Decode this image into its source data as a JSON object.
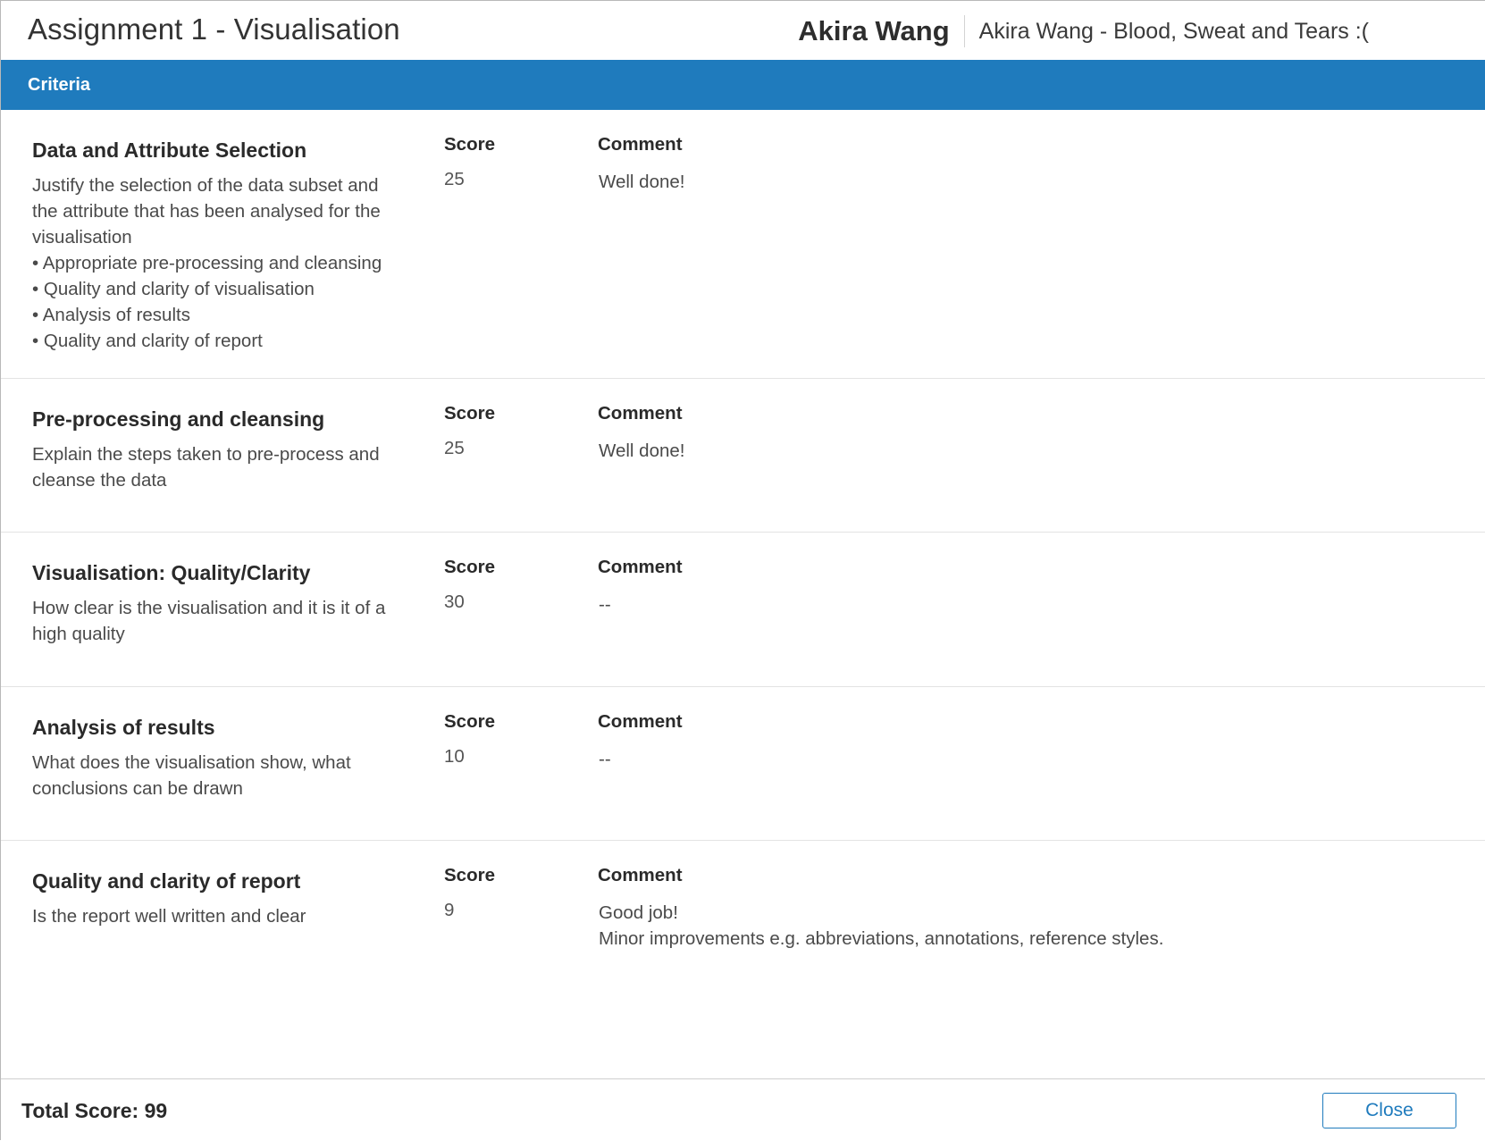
{
  "header": {
    "title": "Assignment 1 - Visualisation",
    "student_name": "Akira Wang",
    "submission_title": "Akira Wang - Blood, Sweat and Tears :("
  },
  "criteria_bar": {
    "label": "Criteria"
  },
  "column_labels": {
    "score": "Score",
    "comment": "Comment"
  },
  "criteria": [
    {
      "title": "Data and Attribute Selection",
      "description": "Justify the selection of the data subset and the attribute that has been analysed for the visualisation\n• Appropriate pre-processing and cleansing\n• Quality and clarity of visualisation\n• Analysis of results\n• Quality and clarity of report",
      "score": "25",
      "comment": "Well done!"
    },
    {
      "title": "Pre-processing and cleansing",
      "description": "Explain the steps taken to pre-process and cleanse the data",
      "score": "25",
      "comment": "Well done!"
    },
    {
      "title": "Visualisation: Quality/Clarity",
      "description": "How clear is the visualisation and it is it of a high quality",
      "score": "30",
      "comment": "--"
    },
    {
      "title": "Analysis of results",
      "description": "What does the visualisation show, what conclusions can be drawn",
      "score": "10",
      "comment": "--"
    },
    {
      "title": "Quality and clarity of report",
      "description": "Is the report well written and clear",
      "score": "9",
      "comment": "Good job!\nMinor improvements e.g. abbreviations, annotations, reference styles."
    }
  ],
  "footer": {
    "total_score": "Total Score: 99",
    "close_label": "Close"
  },
  "colors": {
    "accent": "#1f7bbd"
  }
}
